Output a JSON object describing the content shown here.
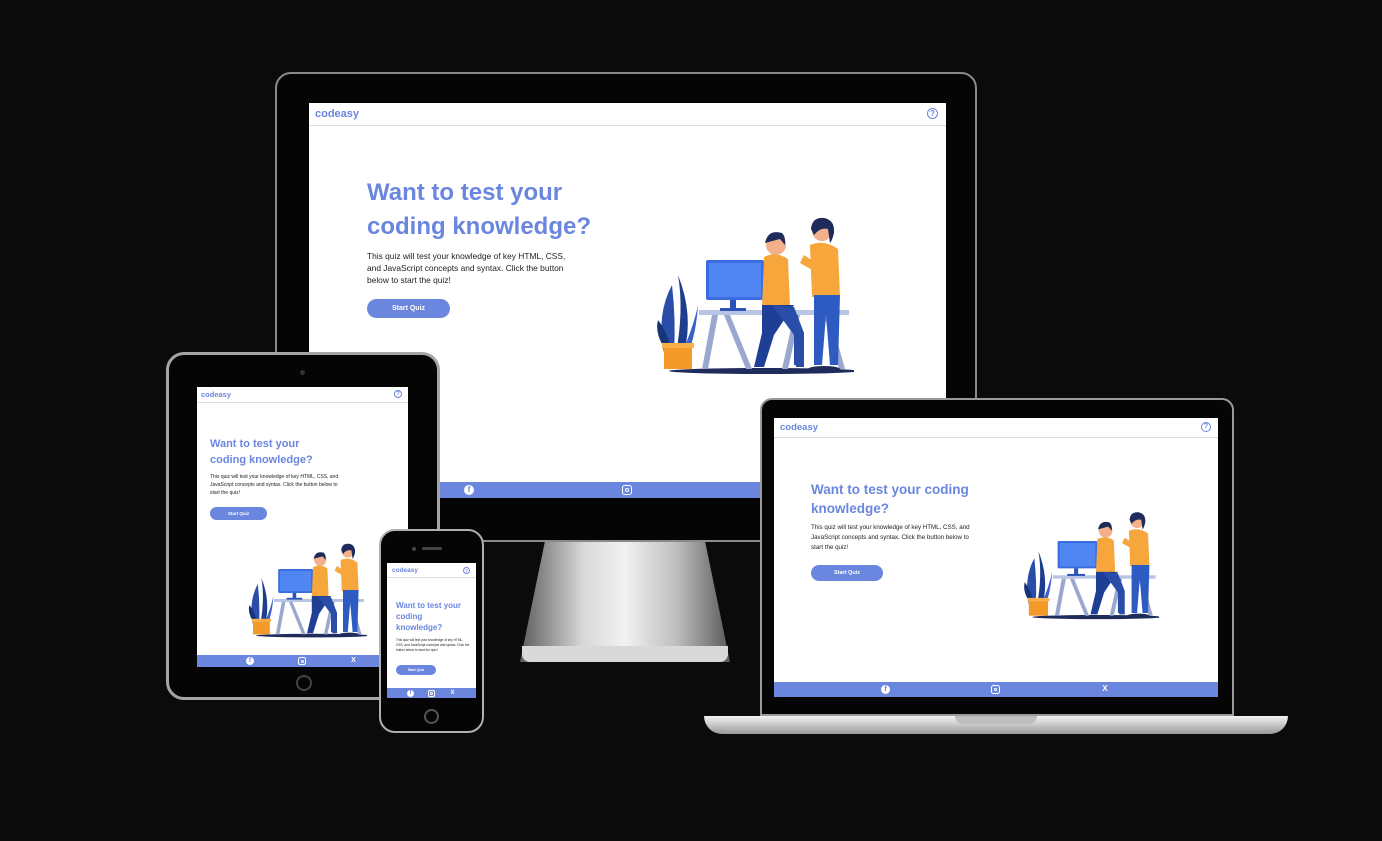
{
  "site": {
    "logo": "codeasy",
    "help_icon": "question-circle-icon",
    "help_glyph": "?",
    "heading": "Want to test your coding knowledge?",
    "intro": "This quiz will test your knowledge of key HTML, CSS, and JavaScript concepts and syntax. Click the button below to start the quiz!",
    "start_button": "Start Quiz",
    "footer_icons": [
      "facebook-icon",
      "instagram-icon",
      "x-icon"
    ],
    "footer_glyph_facebook": "f",
    "footer_glyph_x": "X",
    "illustration": "two-people-at-computer-desk-illustration"
  },
  "desktop_footer_remnant": "the top-left of the monitor footer is hidden behind the tablet",
  "colors": {
    "brand": "#6a86df",
    "background": "#0b0b0b",
    "screen": "#ffffff",
    "text": "#222222"
  }
}
